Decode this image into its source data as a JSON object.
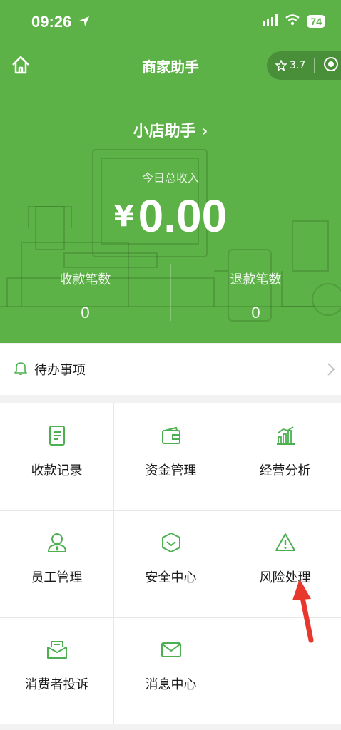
{
  "status_bar": {
    "time": "09:26",
    "battery": "74"
  },
  "nav": {
    "title": "商家助手",
    "rating": "3.7"
  },
  "shop": {
    "name": "小店助手 ›"
  },
  "income": {
    "label": "今日总收入",
    "currency": "¥",
    "amount": "0.00"
  },
  "stats": [
    {
      "label": "收款笔数",
      "value": "0"
    },
    {
      "label": "退款笔数",
      "value": "0"
    }
  ],
  "todo": {
    "label": "待办事项"
  },
  "menu": [
    {
      "label": "收款记录",
      "icon": "receipt-icon"
    },
    {
      "label": "资金管理",
      "icon": "wallet-icon"
    },
    {
      "label": "经营分析",
      "icon": "bar-chart-icon"
    },
    {
      "label": "员工管理",
      "icon": "staff-icon"
    },
    {
      "label": "安全中心",
      "icon": "shield-icon"
    },
    {
      "label": "风险处理",
      "icon": "warning-icon"
    },
    {
      "label": "消费者投诉",
      "icon": "complaint-icon"
    },
    {
      "label": "消息中心",
      "icon": "mail-icon"
    }
  ],
  "colors": {
    "brand_green": "#5cb246",
    "icon_green": "#4caf50",
    "annotation_red": "#e8372c"
  }
}
